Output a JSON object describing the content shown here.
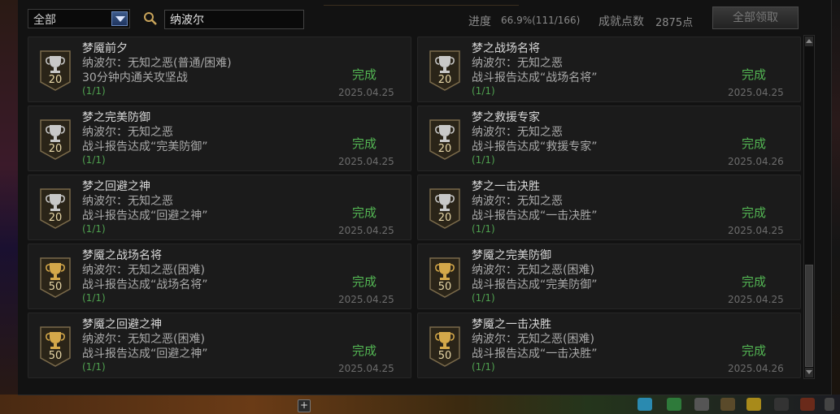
{
  "toolbar": {
    "filter_value": "全部",
    "search_value": "纳波尔",
    "progress_label": "进度",
    "progress_value": "66.9%(111/166)",
    "points_label": "成就点数",
    "points_value": "2875点",
    "claim_all_label": "全部领取"
  },
  "colors": {
    "complete": "#53b653",
    "badge_silver": "#c8c8c8",
    "badge_gold": "#d4a84a"
  },
  "achievements": [
    {
      "title": "梦魇前夕",
      "line1": "纳波尔：无知之恶(普通/困难)",
      "line2": "30分钟内通关攻坚战",
      "count": "(1/1)",
      "status": "完成",
      "date": "2025.04.25",
      "points": "20",
      "tier": "silver"
    },
    {
      "title": "梦之战场名将",
      "line1": "纳波尔：无知之恶",
      "line2": "战斗报告达成“战场名将”",
      "count": "(1/1)",
      "status": "完成",
      "date": "2025.04.25",
      "points": "20",
      "tier": "silver"
    },
    {
      "title": "梦之完美防御",
      "line1": "纳波尔：无知之恶",
      "line2": "战斗报告达成“完美防御”",
      "count": "(1/1)",
      "status": "完成",
      "date": "2025.04.25",
      "points": "20",
      "tier": "silver"
    },
    {
      "title": "梦之救援专家",
      "line1": "纳波尔：无知之恶",
      "line2": "战斗报告达成“救援专家”",
      "count": "(1/1)",
      "status": "完成",
      "date": "2025.04.26",
      "points": "20",
      "tier": "silver"
    },
    {
      "title": "梦之回避之神",
      "line1": "纳波尔：无知之恶",
      "line2": "战斗报告达成“回避之神”",
      "count": "(1/1)",
      "status": "完成",
      "date": "2025.04.25",
      "points": "20",
      "tier": "silver"
    },
    {
      "title": "梦之一击决胜",
      "line1": "纳波尔：无知之恶",
      "line2": "战斗报告达成“一击决胜”",
      "count": "(1/1)",
      "status": "完成",
      "date": "2025.04.25",
      "points": "20",
      "tier": "silver"
    },
    {
      "title": "梦魇之战场名将",
      "line1": "纳波尔：无知之恶(困难)",
      "line2": "战斗报告达成“战场名将”",
      "count": "(1/1)",
      "status": "完成",
      "date": "2025.04.25",
      "points": "50",
      "tier": "gold"
    },
    {
      "title": "梦魇之完美防御",
      "line1": "纳波尔：无知之恶(困难)",
      "line2": "战斗报告达成“完美防御”",
      "count": "(1/1)",
      "status": "完成",
      "date": "2025.04.25",
      "points": "50",
      "tier": "gold"
    },
    {
      "title": "梦魇之回避之神",
      "line1": "纳波尔：无知之恶(困难)",
      "line2": "战斗报告达成“回避之神”",
      "count": "(1/1)",
      "status": "完成",
      "date": "2025.04.25",
      "points": "50",
      "tier": "gold"
    },
    {
      "title": "梦魇之一击决胜",
      "line1": "纳波尔：无知之恶(困难)",
      "line2": "战斗报告达成“一击决胜”",
      "count": "(1/1)",
      "status": "完成",
      "date": "2025.04.26",
      "points": "50",
      "tier": "gold"
    }
  ]
}
